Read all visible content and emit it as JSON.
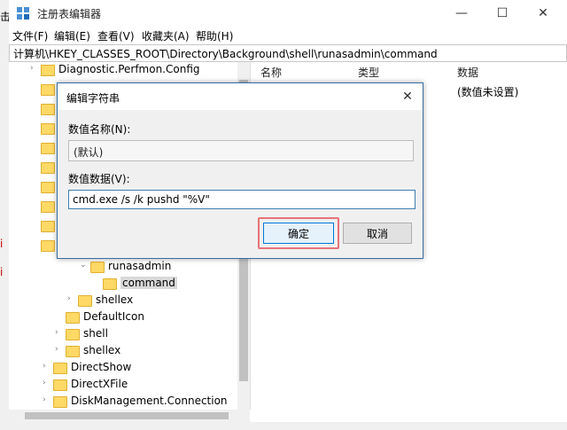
{
  "window": {
    "title": "注册表编辑器",
    "minimize_glyph": "—",
    "maximize_glyph": "☐",
    "close_glyph": "✕"
  },
  "left_strip": {
    "chars": [
      "击",
      "i",
      "i"
    ],
    "accent": "#c00000"
  },
  "menu": {
    "items": [
      "文件(F)",
      "编辑(E)",
      "查看(V)",
      "收藏夹(A)",
      "帮助(H)"
    ]
  },
  "address": {
    "path": "计算机\\HKEY_CLASSES_ROOT\\Directory\\Background\\shell\\runasadmin\\command"
  },
  "tree": {
    "items": [
      {
        "label": "Diagnostic.Perfmon.Config",
        "chevron": "›"
      },
      {
        "label": "runasadmin",
        "chevron": "⌄"
      },
      {
        "label": "command",
        "chevron": "",
        "selected": true
      },
      {
        "label": "shellex",
        "chevron": "›"
      },
      {
        "label": "DefaultIcon",
        "chevron": ""
      },
      {
        "label": "shell",
        "chevron": "›"
      },
      {
        "label": "shellex",
        "chevron": "›"
      },
      {
        "label": "DirectShow",
        "chevron": "›"
      },
      {
        "label": "DirectXFile",
        "chevron": "›"
      },
      {
        "label": "DiskManagement.Connection",
        "chevron": "›"
      }
    ]
  },
  "right_pane": {
    "columns": [
      "名称",
      "类型",
      "数据"
    ],
    "rows": [
      {
        "data": "(数值未设置)"
      }
    ]
  },
  "dialog": {
    "title": "编辑字符串",
    "close_glyph": "✕",
    "name_label": "数值名称(N):",
    "name_value": "(默认)",
    "data_label": "数值数据(V):",
    "data_value": "cmd.exe /s /k pushd \"%V\"",
    "ok_label": "确定",
    "cancel_label": "取消",
    "highlight_color": "#e8737a"
  }
}
